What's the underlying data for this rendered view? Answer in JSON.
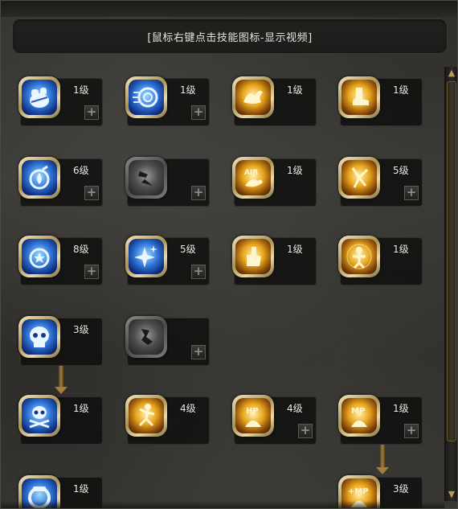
{
  "header": {
    "text": "[鼠标右键点击技能图标-显示视频]"
  },
  "scrollbar": {
    "up_glyph": "▲",
    "down_glyph": "▼"
  },
  "plus_glyph": "+",
  "skills": [
    {
      "level": "1级",
      "icon": "punch-gauntlet-icon",
      "style": "blue"
    },
    {
      "level": "1级",
      "icon": "spiral-vortex-icon",
      "style": "blue"
    },
    {
      "level": "1级",
      "icon": "phoenix-strike-icon",
      "style": "gold"
    },
    {
      "level": "1级",
      "icon": "boot-kick-icon",
      "style": "gold"
    },
    {
      "level": "6级",
      "icon": "flame-fist-icon",
      "style": "blue"
    },
    {
      "level": "",
      "icon": "locked-dash-icon",
      "style": "grey"
    },
    {
      "level": "1级",
      "icon": "air-combo-icon",
      "style": "gold"
    },
    {
      "level": "5级",
      "icon": "flying-kick-icon",
      "style": "gold"
    },
    {
      "level": "8级",
      "icon": "star-fist-icon",
      "style": "blue"
    },
    {
      "level": "5级",
      "icon": "sparkle-stars-icon",
      "style": "blue"
    },
    {
      "level": "1级",
      "icon": "thumbs-up-icon",
      "style": "gold"
    },
    {
      "level": "1级",
      "icon": "glowing-figure-icon",
      "style": "gold"
    },
    {
      "level": "3级",
      "icon": "skull-icon",
      "style": "blue"
    },
    {
      "level": "",
      "icon": "locked-stance-icon",
      "style": "grey"
    },
    {
      "level": "1级",
      "icon": "skull-crossbones-icon",
      "style": "blue"
    },
    {
      "level": "4级",
      "icon": "dancing-figure-icon",
      "style": "gold"
    },
    {
      "level": "4级",
      "icon": "hp-boost-icon",
      "style": "gold"
    },
    {
      "level": "1级",
      "icon": "mp-boost-icon",
      "style": "gold"
    },
    {
      "level": "1级",
      "icon": "shield-ring-icon",
      "style": "blue"
    },
    {
      "level": "3级",
      "icon": "mp-plus-icon",
      "style": "gold"
    }
  ],
  "icon_text": {
    "air": "AIR",
    "hp": "HP",
    "mp": "MP",
    "mp_plus": "+MP"
  }
}
